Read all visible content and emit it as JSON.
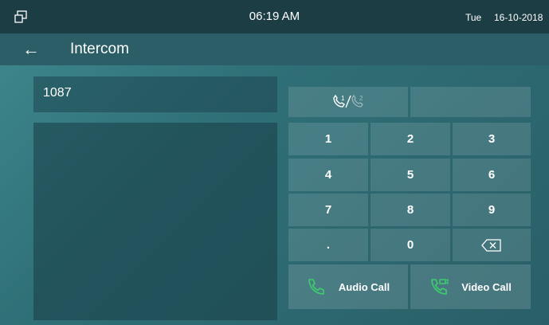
{
  "status_bar": {
    "time": "06:19 AM",
    "day": "Tue",
    "date": "16-10-2018",
    "left_icon": "window-restore-icon"
  },
  "header": {
    "back_icon": "back-arrow-icon",
    "back_glyph": "←",
    "title": "Intercom"
  },
  "dial_input": {
    "value": "1087"
  },
  "line_selector": {
    "icon": "line-switch-icon",
    "line_1": "1",
    "line_2": "2",
    "active_line": "1"
  },
  "keypad": {
    "keys": [
      "1",
      "2",
      "3",
      "4",
      "5",
      "6",
      "7",
      "8",
      "9",
      ".",
      "0"
    ],
    "backspace_icon": "backspace-icon"
  },
  "actions": {
    "audio_call": {
      "label": "Audio Call",
      "icon": "phone-icon"
    },
    "video_call": {
      "label": "Video Call",
      "icon": "video-phone-icon"
    }
  },
  "colors": {
    "status_bar_bg": "#1d3d45",
    "title_bar_bg": "#2b5e66",
    "call_icon_green": "#3ccf6e",
    "text": "#ffffff"
  }
}
